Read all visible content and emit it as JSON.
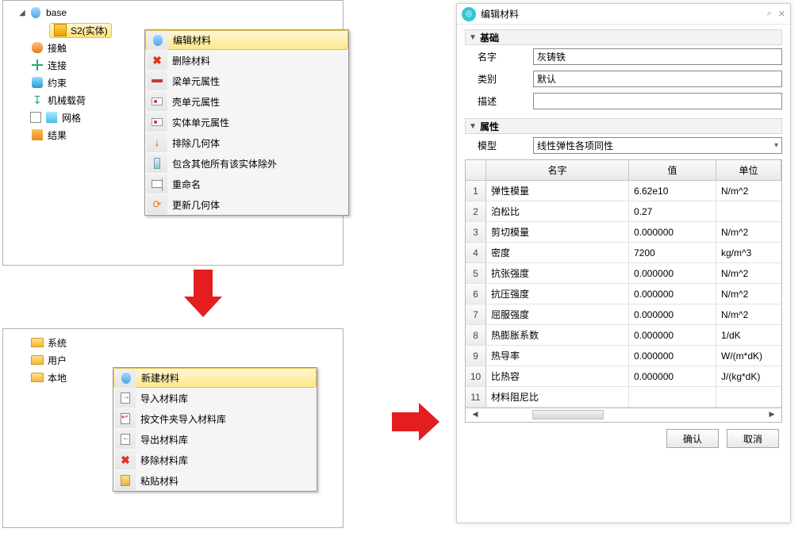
{
  "tree": {
    "root": "base",
    "selected": "S2(实体)",
    "items": [
      {
        "label": "接触"
      },
      {
        "label": "连接"
      },
      {
        "label": "约束"
      },
      {
        "label": "机械载荷"
      },
      {
        "label": "网格",
        "checkbox": true
      },
      {
        "label": "结果"
      }
    ]
  },
  "ctx1": {
    "items": [
      {
        "label": "编辑材料",
        "highlight": true
      },
      {
        "label": "删除材料"
      },
      {
        "label": "梁单元属性"
      },
      {
        "label": "壳单元属性"
      },
      {
        "label": "实体单元属性"
      },
      {
        "label": "排除几何体"
      },
      {
        "label": "包含其他所有该实体除外"
      },
      {
        "label": "重命名"
      },
      {
        "label": "更新几何体"
      }
    ]
  },
  "library": {
    "items": [
      {
        "label": "系统"
      },
      {
        "label": "用户"
      },
      {
        "label": "本地"
      }
    ]
  },
  "ctx2": {
    "items": [
      {
        "label": "新建材料",
        "highlight": true
      },
      {
        "label": "导入材料库"
      },
      {
        "label": "按文件夹导入材料库"
      },
      {
        "label": "导出材料库"
      },
      {
        "label": "移除材料库"
      },
      {
        "label": "粘贴材料"
      }
    ]
  },
  "dialog": {
    "title": "编辑材料",
    "sections": {
      "basic": "基础",
      "props": "属性"
    },
    "fields": {
      "name_label": "名字",
      "name_value": "灰铸铁",
      "cat_label": "类别",
      "cat_value": "默认",
      "desc_label": "描述",
      "desc_value": "",
      "model_label": "模型",
      "model_value": "线性弹性各项同性"
    },
    "table": {
      "headers": {
        "name": "名字",
        "value": "值",
        "unit": "单位"
      },
      "rows": [
        {
          "i": "1",
          "name": "弹性模量",
          "value": "6.62e10",
          "unit": "N/m^2"
        },
        {
          "i": "2",
          "name": "泊松比",
          "value": "0.27",
          "unit": ""
        },
        {
          "i": "3",
          "name": "剪切模量",
          "value": "0.000000",
          "unit": "N/m^2"
        },
        {
          "i": "4",
          "name": "密度",
          "value": "7200",
          "unit": "kg/m^3"
        },
        {
          "i": "5",
          "name": "抗张强度",
          "value": "0.000000",
          "unit": "N/m^2"
        },
        {
          "i": "6",
          "name": "抗压强度",
          "value": "0.000000",
          "unit": "N/m^2"
        },
        {
          "i": "7",
          "name": "屈服强度",
          "value": "0.000000",
          "unit": "N/m^2"
        },
        {
          "i": "8",
          "name": "热膨胀系数",
          "value": "0.000000",
          "unit": "1/dK"
        },
        {
          "i": "9",
          "name": "热导率",
          "value": "0.000000",
          "unit": "W/(m*dK)"
        },
        {
          "i": "10",
          "name": "比热容",
          "value": "0.000000",
          "unit": "J/(kg*dK)"
        },
        {
          "i": "11",
          "name": "材料阻尼比",
          "value": "",
          "unit": ""
        }
      ]
    },
    "buttons": {
      "ok": "确认",
      "cancel": "取消"
    }
  }
}
